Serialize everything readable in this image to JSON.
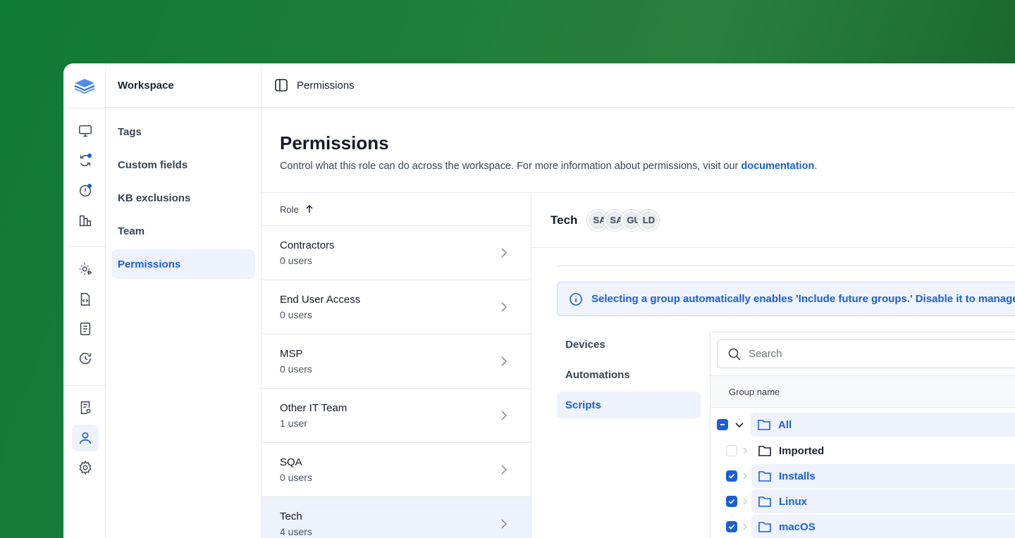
{
  "app": {
    "colors": {
      "accent": "#1b5fd4",
      "accent_bg": "#edf2fc",
      "border": "#e6e8ec"
    }
  },
  "rail": {
    "icons": [
      "layers-logo-icon",
      "monitor-icon",
      "sync-icon",
      "alert-icon",
      "buildings-icon",
      "settings-play-icon",
      "code-file-icon",
      "document-icon",
      "history-icon",
      "clipboard-settings-icon",
      "user-icon",
      "gear-icon"
    ]
  },
  "workspace": {
    "title": "Workspace",
    "items": [
      {
        "label": "Tags"
      },
      {
        "label": "Custom fields"
      },
      {
        "label": "KB exclusions"
      },
      {
        "label": "Team"
      },
      {
        "label": "Permissions"
      }
    ]
  },
  "topbar": {
    "title": "Permissions"
  },
  "page": {
    "title": "Permissions",
    "description": "Control what this role can do across the workspace. For more information about permissions, visit our ",
    "doc_link": "documentation",
    "doc_suffix": "."
  },
  "roles": {
    "header": "Role",
    "items": [
      {
        "name": "Contractors",
        "users": "0 users"
      },
      {
        "name": "End User Access",
        "users": "0 users"
      },
      {
        "name": "MSP",
        "users": "0 users"
      },
      {
        "name": "Other IT Team",
        "users": "1 user"
      },
      {
        "name": "SQA",
        "users": "0 users"
      },
      {
        "name": "Tech",
        "users": "4 users"
      }
    ]
  },
  "detail": {
    "title": "Tech",
    "avatars": [
      "SA",
      "SA",
      "GU",
      "LD"
    ],
    "banner": "Selecting a group automatically enables 'Include future groups.' Disable it to manage sub",
    "tabs": [
      {
        "label": "Devices"
      },
      {
        "label": "Automations"
      },
      {
        "label": "Scripts"
      }
    ],
    "search_placeholder": "Search",
    "grid_header": "Group name",
    "groups": [
      {
        "name": "All",
        "state": "mixed",
        "expanded": true
      },
      {
        "name": "Imported",
        "state": "unchecked"
      },
      {
        "name": "Installs",
        "state": "checked"
      },
      {
        "name": "Linux",
        "state": "checked"
      },
      {
        "name": "macOS",
        "state": "checked"
      }
    ]
  }
}
